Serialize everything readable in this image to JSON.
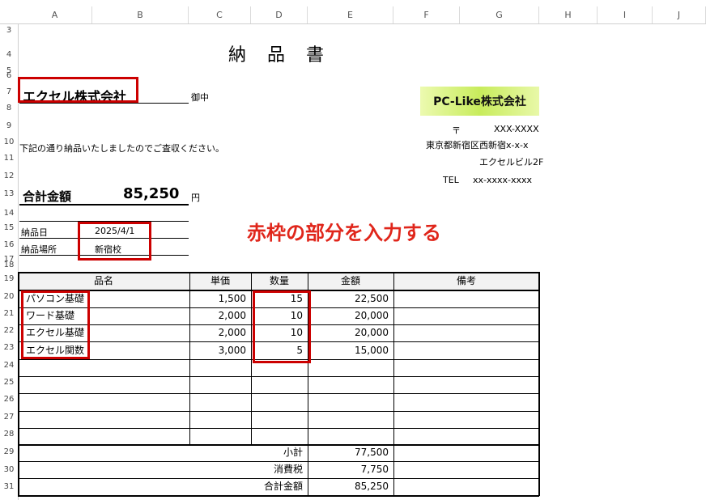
{
  "columns": [
    "A",
    "B",
    "C",
    "D",
    "E",
    "F",
    "G",
    "H",
    "I",
    "J"
  ],
  "rows": [
    "3",
    "4",
    "5",
    "6",
    "7",
    "8",
    "9",
    "10",
    "11",
    "12",
    "13",
    "14",
    "15",
    "16",
    "17",
    "18",
    "19",
    "20",
    "21",
    "22",
    "23",
    "24",
    "25",
    "26",
    "27",
    "28",
    "29",
    "30",
    "31"
  ],
  "doc": {
    "title": "納　品　書",
    "customer_name": "エクセル株式会社",
    "honorific": "御中",
    "message": "下記の通り納品いたしましたのでご査収ください。",
    "total_label": "合計金額",
    "total_value": "85,250",
    "total_unit": "円",
    "delivery_date_label": "納品日",
    "delivery_date": "2025/4/1",
    "delivery_place_label": "納品場所",
    "delivery_place": "新宿校",
    "annotation": "赤枠の部分を入力する"
  },
  "company": {
    "logo": "PC-Like株式会社",
    "postal_mark": "〒",
    "postal_code": "XXX-XXXX",
    "address1": "東京都新宿区西新宿x-x-x",
    "address2": "エクセルビル2F",
    "tel_label": "TEL",
    "tel": "xx-xxxx-xxxx"
  },
  "table": {
    "headers": [
      "品名",
      "単価",
      "数量",
      "金額",
      "備考"
    ],
    "items": [
      {
        "name": "パソコン基礎",
        "price": "1,500",
        "qty": "15",
        "amount": "22,500"
      },
      {
        "name": "ワード基礎",
        "price": "2,000",
        "qty": "10",
        "amount": "20,000"
      },
      {
        "name": "エクセル基礎",
        "price": "2,000",
        "qty": "10",
        "amount": "20,000"
      },
      {
        "name": "エクセル関数",
        "price": "3,000",
        "qty": "5",
        "amount": "15,000"
      }
    ],
    "subtotal_label": "小計",
    "subtotal": "77,500",
    "tax_label": "消費税",
    "tax": "7,750",
    "grand_label": "合計金額",
    "grand": "85,250"
  },
  "colors": {
    "red_box": "#cc0000",
    "annotation_text": "#e0261b",
    "logo_grad_a": "#e8f8a0",
    "logo_grad_b": "#b8e040"
  }
}
